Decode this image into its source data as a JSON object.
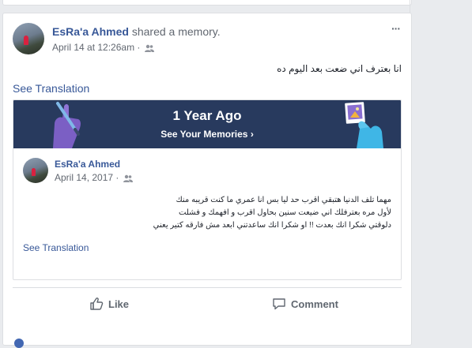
{
  "post": {
    "author": "EsRa'a Ahmed",
    "action_text": " shared a memory.",
    "timestamp": "April 14 at 12:26am",
    "separator": " · ",
    "more_label": "···",
    "text": "انا بعترف اني ضعت بعد اليوم ده",
    "see_translation": "See Translation"
  },
  "memory": {
    "banner_title": "1 Year Ago",
    "banner_link": "See Your Memories",
    "banner_link_arrow": "›",
    "inner_author": "EsRa'a Ahmed",
    "inner_date": "April 14, 2017",
    "inner_separator": " · ",
    "inner_lines": [
      "مهما تلف الدنيا هتبقي اقرب حد ليا بس انا عمري ما كنت قريبه منك",
      "لأول مره بعترفلك اني ضيعت سنين بحاول اقرب و افهمك و فشلت",
      "دلوقتي شكرا انك بعدت !! او شكرا انك ساعدتني ابعد مش فارقه كتير يعني"
    ],
    "see_translation": "See Translation"
  },
  "actions": {
    "like": "Like",
    "comment": "Comment"
  },
  "colors": {
    "link": "#385898",
    "banner": "#283a5e",
    "muted": "#616770",
    "page_bg": "#e9ebee"
  },
  "icons": [
    "friends-icon",
    "more-options-icon",
    "pencil-hand-icon",
    "photo-hand-icon",
    "chevron-right-icon",
    "like-icon",
    "comment-icon"
  ]
}
